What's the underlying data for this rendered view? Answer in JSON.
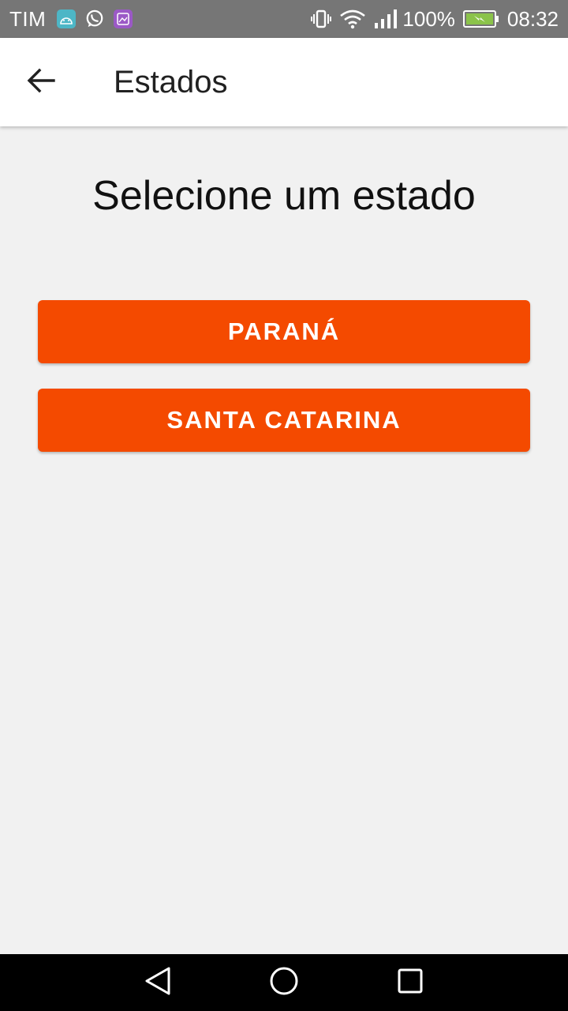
{
  "status_bar": {
    "carrier": "TIM",
    "battery_percent": "100%",
    "time": "08:32",
    "notification_icons": [
      "android-icon",
      "whatsapp-icon",
      "gallery-icon"
    ],
    "system_icons": [
      "vibrate-icon",
      "wifi-icon",
      "signal-icon",
      "battery-charging-icon"
    ],
    "colors": {
      "background": "#767676",
      "battery_fill": "#8bc34a"
    }
  },
  "app_bar": {
    "title": "Estados",
    "back_icon": "arrow-back-icon"
  },
  "main": {
    "prompt": "Selecione um estado",
    "buttons": [
      {
        "label": "PARANÁ"
      },
      {
        "label": "SANTA CATARINA"
      }
    ],
    "colors": {
      "button": "#f44a00",
      "background": "#f1f1f1"
    }
  },
  "nav_bar": {
    "icons": [
      "nav-back-icon",
      "nav-home-icon",
      "nav-recents-icon"
    ]
  }
}
